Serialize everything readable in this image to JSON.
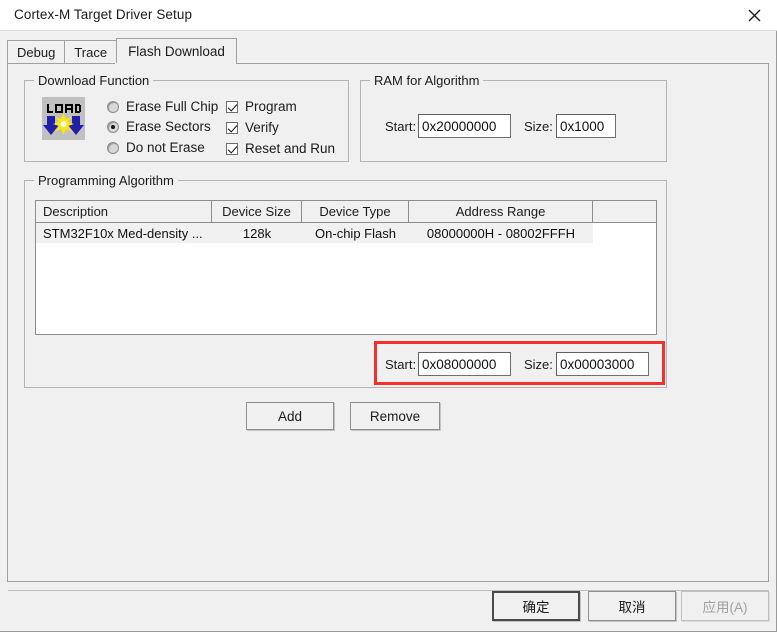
{
  "window": {
    "title": "Cortex-M Target Driver Setup",
    "close_icon": "close-icon"
  },
  "tabs": [
    {
      "label": "Debug",
      "active": false
    },
    {
      "label": "Trace",
      "active": false
    },
    {
      "label": "Flash Download",
      "active": true
    }
  ],
  "download_function": {
    "legend": "Download Function",
    "icon": "load-icon",
    "icon_text": "LOAD",
    "radios": [
      {
        "label": "Erase Full Chip",
        "checked": false
      },
      {
        "label": "Erase Sectors",
        "checked": true
      },
      {
        "label": "Do not Erase",
        "checked": false
      }
    ],
    "checkboxes": [
      {
        "label": "Program",
        "checked": true
      },
      {
        "label": "Verify",
        "checked": true
      },
      {
        "label": "Reset and Run",
        "checked": true
      }
    ]
  },
  "ram_for_algorithm": {
    "legend": "RAM for Algorithm",
    "start_label": "Start:",
    "start_value": "0x20000000",
    "size_label": "Size:",
    "size_value": "0x1000"
  },
  "programming_algorithm": {
    "legend": "Programming Algorithm",
    "columns": [
      "Description",
      "Device Size",
      "Device Type",
      "Address Range",
      ""
    ],
    "rows": [
      {
        "description": "STM32F10x Med-density ...",
        "device_size": "128k",
        "device_type": "On-chip Flash",
        "address_range": "08000000H - 08002FFFH",
        "extra": ""
      }
    ],
    "range": {
      "start_label": "Start:",
      "start_value": "0x08000000",
      "size_label": "Size:",
      "size_value": "0x00003000",
      "highlight_color": "#f2302e"
    },
    "add_label": "Add",
    "remove_label": "Remove"
  },
  "footer": {
    "ok_label": "确定",
    "cancel_label": "取消",
    "apply_label": "应用(A)",
    "apply_disabled": true
  }
}
